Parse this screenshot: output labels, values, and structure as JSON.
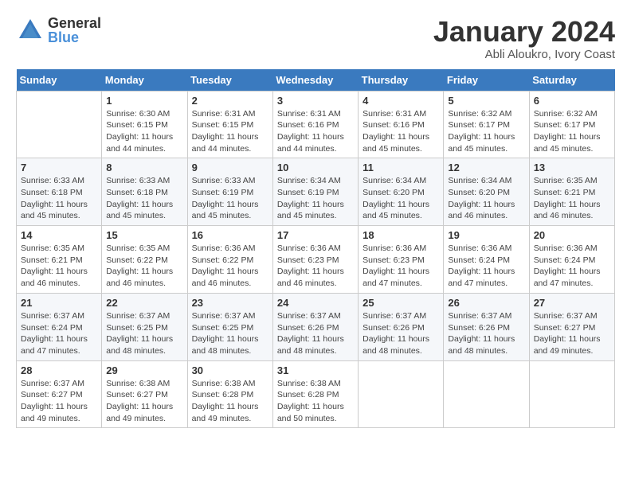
{
  "logo": {
    "general": "General",
    "blue": "Blue"
  },
  "title": "January 2024",
  "subtitle": "Abli Aloukro, Ivory Coast",
  "days_header": [
    "Sunday",
    "Monday",
    "Tuesday",
    "Wednesday",
    "Thursday",
    "Friday",
    "Saturday"
  ],
  "weeks": [
    [
      {
        "day": "",
        "info": ""
      },
      {
        "day": "1",
        "info": "Sunrise: 6:30 AM\nSunset: 6:15 PM\nDaylight: 11 hours\nand 44 minutes."
      },
      {
        "day": "2",
        "info": "Sunrise: 6:31 AM\nSunset: 6:15 PM\nDaylight: 11 hours\nand 44 minutes."
      },
      {
        "day": "3",
        "info": "Sunrise: 6:31 AM\nSunset: 6:16 PM\nDaylight: 11 hours\nand 44 minutes."
      },
      {
        "day": "4",
        "info": "Sunrise: 6:31 AM\nSunset: 6:16 PM\nDaylight: 11 hours\nand 45 minutes."
      },
      {
        "day": "5",
        "info": "Sunrise: 6:32 AM\nSunset: 6:17 PM\nDaylight: 11 hours\nand 45 minutes."
      },
      {
        "day": "6",
        "info": "Sunrise: 6:32 AM\nSunset: 6:17 PM\nDaylight: 11 hours\nand 45 minutes."
      }
    ],
    [
      {
        "day": "7",
        "info": "Sunrise: 6:33 AM\nSunset: 6:18 PM\nDaylight: 11 hours\nand 45 minutes."
      },
      {
        "day": "8",
        "info": "Sunrise: 6:33 AM\nSunset: 6:18 PM\nDaylight: 11 hours\nand 45 minutes."
      },
      {
        "day": "9",
        "info": "Sunrise: 6:33 AM\nSunset: 6:19 PM\nDaylight: 11 hours\nand 45 minutes."
      },
      {
        "day": "10",
        "info": "Sunrise: 6:34 AM\nSunset: 6:19 PM\nDaylight: 11 hours\nand 45 minutes."
      },
      {
        "day": "11",
        "info": "Sunrise: 6:34 AM\nSunset: 6:20 PM\nDaylight: 11 hours\nand 45 minutes."
      },
      {
        "day": "12",
        "info": "Sunrise: 6:34 AM\nSunset: 6:20 PM\nDaylight: 11 hours\nand 46 minutes."
      },
      {
        "day": "13",
        "info": "Sunrise: 6:35 AM\nSunset: 6:21 PM\nDaylight: 11 hours\nand 46 minutes."
      }
    ],
    [
      {
        "day": "14",
        "info": "Sunrise: 6:35 AM\nSunset: 6:21 PM\nDaylight: 11 hours\nand 46 minutes."
      },
      {
        "day": "15",
        "info": "Sunrise: 6:35 AM\nSunset: 6:22 PM\nDaylight: 11 hours\nand 46 minutes."
      },
      {
        "day": "16",
        "info": "Sunrise: 6:36 AM\nSunset: 6:22 PM\nDaylight: 11 hours\nand 46 minutes."
      },
      {
        "day": "17",
        "info": "Sunrise: 6:36 AM\nSunset: 6:23 PM\nDaylight: 11 hours\nand 46 minutes."
      },
      {
        "day": "18",
        "info": "Sunrise: 6:36 AM\nSunset: 6:23 PM\nDaylight: 11 hours\nand 47 minutes."
      },
      {
        "day": "19",
        "info": "Sunrise: 6:36 AM\nSunset: 6:24 PM\nDaylight: 11 hours\nand 47 minutes."
      },
      {
        "day": "20",
        "info": "Sunrise: 6:36 AM\nSunset: 6:24 PM\nDaylight: 11 hours\nand 47 minutes."
      }
    ],
    [
      {
        "day": "21",
        "info": "Sunrise: 6:37 AM\nSunset: 6:24 PM\nDaylight: 11 hours\nand 47 minutes."
      },
      {
        "day": "22",
        "info": "Sunrise: 6:37 AM\nSunset: 6:25 PM\nDaylight: 11 hours\nand 48 minutes."
      },
      {
        "day": "23",
        "info": "Sunrise: 6:37 AM\nSunset: 6:25 PM\nDaylight: 11 hours\nand 48 minutes."
      },
      {
        "day": "24",
        "info": "Sunrise: 6:37 AM\nSunset: 6:26 PM\nDaylight: 11 hours\nand 48 minutes."
      },
      {
        "day": "25",
        "info": "Sunrise: 6:37 AM\nSunset: 6:26 PM\nDaylight: 11 hours\nand 48 minutes."
      },
      {
        "day": "26",
        "info": "Sunrise: 6:37 AM\nSunset: 6:26 PM\nDaylight: 11 hours\nand 48 minutes."
      },
      {
        "day": "27",
        "info": "Sunrise: 6:37 AM\nSunset: 6:27 PM\nDaylight: 11 hours\nand 49 minutes."
      }
    ],
    [
      {
        "day": "28",
        "info": "Sunrise: 6:37 AM\nSunset: 6:27 PM\nDaylight: 11 hours\nand 49 minutes."
      },
      {
        "day": "29",
        "info": "Sunrise: 6:38 AM\nSunset: 6:27 PM\nDaylight: 11 hours\nand 49 minutes."
      },
      {
        "day": "30",
        "info": "Sunrise: 6:38 AM\nSunset: 6:28 PM\nDaylight: 11 hours\nand 49 minutes."
      },
      {
        "day": "31",
        "info": "Sunrise: 6:38 AM\nSunset: 6:28 PM\nDaylight: 11 hours\nand 50 minutes."
      },
      {
        "day": "",
        "info": ""
      },
      {
        "day": "",
        "info": ""
      },
      {
        "day": "",
        "info": ""
      }
    ]
  ]
}
